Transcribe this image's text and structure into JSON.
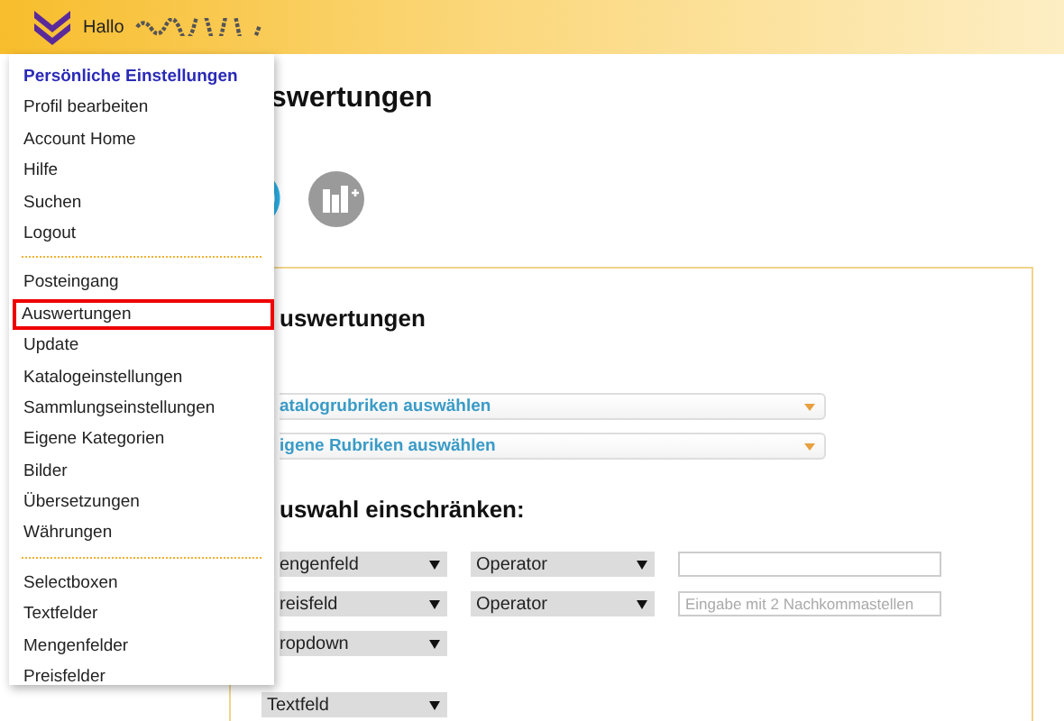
{
  "top_bar": {
    "greeting": "Hallo"
  },
  "menu": {
    "groups": [
      {
        "items": [
          {
            "label": "Persönliche Einstellungen",
            "kind": "header",
            "selected": false
          },
          {
            "label": "Profil bearbeiten",
            "kind": "link",
            "selected": false
          },
          {
            "label": "Account Home",
            "kind": "link",
            "selected": false
          },
          {
            "label": "Hilfe",
            "kind": "link",
            "selected": false
          },
          {
            "label": "Suchen",
            "kind": "link",
            "selected": false
          },
          {
            "label": "Logout",
            "kind": "link",
            "selected": false
          }
        ]
      },
      {
        "items": [
          {
            "label": "Posteingang",
            "kind": "link",
            "selected": false
          },
          {
            "label": "Auswertungen",
            "kind": "link",
            "selected": true
          },
          {
            "label": "Update",
            "kind": "link",
            "selected": false
          },
          {
            "label": "Katalogeinstellungen",
            "kind": "link",
            "selected": false
          },
          {
            "label": "Sammlungseinstellungen",
            "kind": "link",
            "selected": false
          },
          {
            "label": "Eigene Kategorien",
            "kind": "link",
            "selected": false
          },
          {
            "label": "Bilder",
            "kind": "link",
            "selected": false
          },
          {
            "label": "Übersetzungen",
            "kind": "link",
            "selected": false
          },
          {
            "label": "Währungen",
            "kind": "link",
            "selected": false
          }
        ]
      },
      {
        "items": [
          {
            "label": "Selectboxen",
            "kind": "link",
            "selected": false
          },
          {
            "label": "Textfelder",
            "kind": "link",
            "selected": false
          },
          {
            "label": "Mengenfelder",
            "kind": "link",
            "selected": false
          },
          {
            "label": "Preisfelder",
            "kind": "link",
            "selected": false
          }
        ]
      }
    ]
  },
  "page": {
    "title": "swertungen",
    "panel": {
      "title": "uswertungen",
      "dropdowns": [
        "atalogrubriken auswählen",
        "igene Rubriken auswählen"
      ],
      "filter_title": "uswahl einschränken:",
      "rows": [
        {
          "field": "engenfeld",
          "operator": "Operator",
          "value": "",
          "placeholder": ""
        },
        {
          "field": "reisfeld",
          "operator": "Operator",
          "value": "",
          "placeholder": "Eingabe mit 2 Nachkommastellen"
        },
        {
          "field": "ropdown"
        }
      ],
      "last_select": "Textfeld"
    }
  }
}
